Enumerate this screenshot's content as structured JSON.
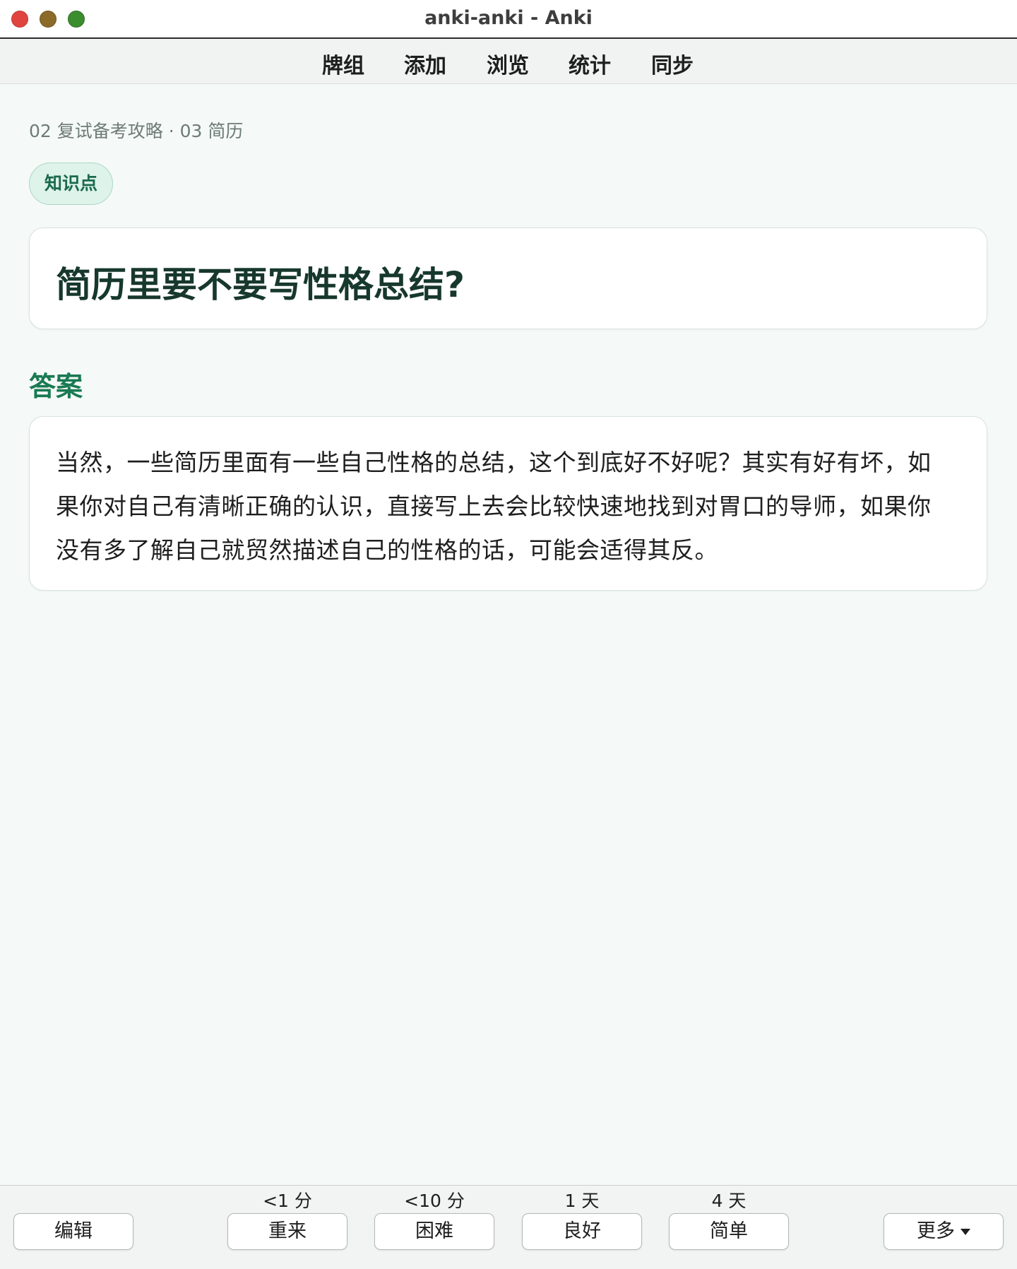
{
  "window": {
    "title": "anki-anki - Anki"
  },
  "toolbar": {
    "items": [
      "牌组",
      "添加",
      "浏览",
      "统计",
      "同步"
    ]
  },
  "card": {
    "breadcrumb": "02 复试备考攻略 · 03 简历",
    "tag": "知识点",
    "question": "简历里要不要写性格总结?",
    "answer_heading": "答案",
    "answer": "当然，一些简历里面有一些自己性格的总结，这个到底好不好呢？其实有好有坏，如果你对自己有清晰正确的认识，直接写上去会比较快速地找到对胃口的导师，如果你没有多了解自己就贸然描述自己的性格的话，可能会适得其反。"
  },
  "bottom": {
    "edit_label": "编辑",
    "more_label": "更多",
    "answers": [
      {
        "interval": "<1 分",
        "label": "重来"
      },
      {
        "interval": "<10 分",
        "label": "困难"
      },
      {
        "interval": "1 天",
        "label": "良好"
      },
      {
        "interval": "4 天",
        "label": "简单"
      }
    ]
  },
  "colors": {
    "accent": "#1a7a52",
    "tag_background": "#def3ea",
    "page_background": "#f5f9f8"
  }
}
